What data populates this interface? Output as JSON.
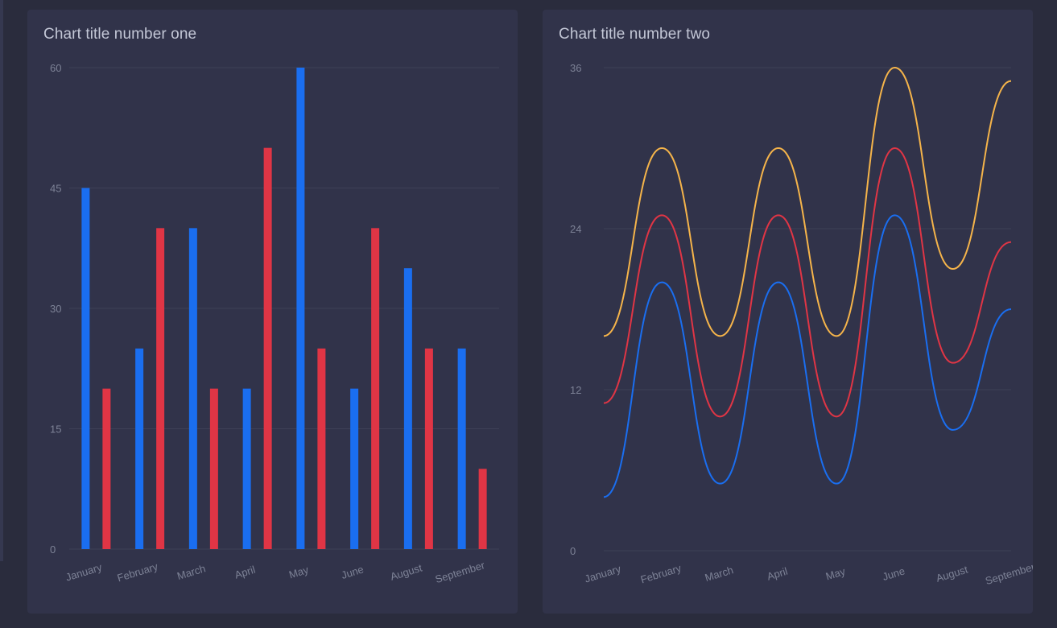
{
  "chart_data": [
    {
      "type": "bar",
      "title": "Chart title number one",
      "categories": [
        "January",
        "February",
        "March",
        "April",
        "May",
        "June",
        "August",
        "September"
      ],
      "ylim": [
        0,
        60
      ],
      "yticks": [
        0,
        15,
        30,
        45,
        60
      ],
      "grid": true,
      "series": [
        {
          "values": [
            45,
            25,
            40,
            20,
            60,
            20,
            35,
            25
          ],
          "color": "#1a6ef0"
        },
        {
          "values": [
            20,
            40,
            20,
            50,
            25,
            40,
            25,
            10
          ],
          "color": "#e03545"
        }
      ]
    },
    {
      "type": "line",
      "title": "Chart title number two",
      "categories": [
        "January",
        "February",
        "March",
        "April",
        "May",
        "June",
        "August",
        "September"
      ],
      "ylim": [
        0,
        36
      ],
      "yticks": [
        0,
        12,
        24,
        36
      ],
      "grid": true,
      "series": [
        {
          "values": [
            4,
            20,
            5,
            20,
            5,
            25,
            9,
            18
          ],
          "color": "#1a6ef0"
        },
        {
          "values": [
            11,
            25,
            10,
            25,
            10,
            30,
            14,
            23
          ],
          "color": "#e03545"
        },
        {
          "values": [
            16,
            30,
            16,
            30,
            16,
            36,
            21,
            35
          ],
          "color": "#f5b44a"
        }
      ]
    }
  ]
}
